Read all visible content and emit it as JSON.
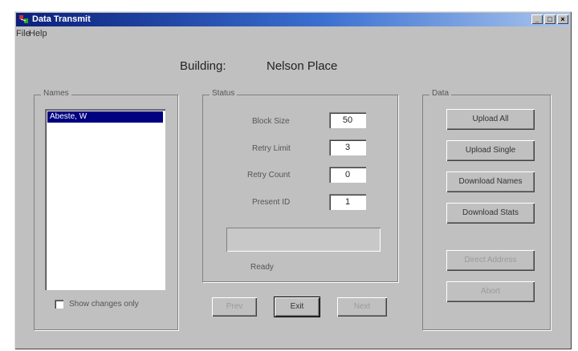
{
  "window": {
    "title": "Data Transmit"
  },
  "menu": {
    "file": "File",
    "help": "Help"
  },
  "header": {
    "label": "Building:",
    "value": "Nelson Place"
  },
  "names": {
    "group_label": "Names",
    "items": [
      "Abeste, W"
    ],
    "show_changes_label": "Show changes only"
  },
  "status": {
    "group_label": "Status",
    "block_size_label": "Block Size",
    "block_size_value": "50",
    "retry_limit_label": "Retry Limit",
    "retry_limit_value": "3",
    "retry_count_label": "Retry Count",
    "retry_count_value": "0",
    "present_id_label": "Present ID",
    "present_id_value": "1",
    "status_text": "Ready"
  },
  "data_panel": {
    "group_label": "Data",
    "upload_all": "Upload All",
    "upload_single": "Upload Single",
    "download_names": "Download Names",
    "download_stats": "Download Stats",
    "direct_address": "Direct Address",
    "abort": "Abort"
  },
  "nav": {
    "prev": "Prev",
    "exit": "Exit",
    "next": "Next"
  }
}
